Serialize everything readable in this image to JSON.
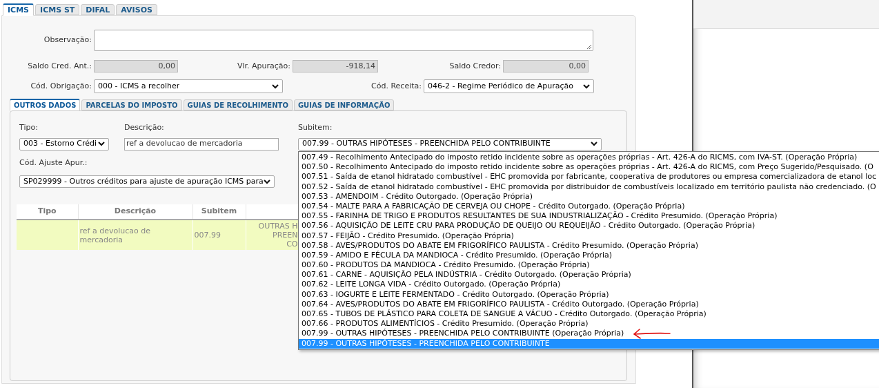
{
  "tabs": [
    {
      "label": "ICMS",
      "selected": true
    },
    {
      "label": "ICMS ST",
      "selected": false
    },
    {
      "label": "DIFAL",
      "selected": false
    },
    {
      "label": "AVISOS",
      "selected": false
    }
  ],
  "observacao": {
    "label": "Observação:"
  },
  "totals": [
    {
      "label": "Saldo Cred. Ant.:",
      "value": "0,00"
    },
    {
      "label": "Vlr. Apuração:",
      "value": "-918,14"
    },
    {
      "label": "Saldo Credor:",
      "value": "0,00"
    }
  ],
  "codes": [
    {
      "label": "Cód. Obrigação:",
      "value": "000 - ICMS a recolher"
    },
    {
      "label": "Cód. Receita:",
      "value": "046-2 - Regime Periódico de Apuração"
    }
  ],
  "subtabs": [
    {
      "label": "OUTROS DADOS",
      "selected": true
    },
    {
      "label": "PARCELAS DO IMPOSTO",
      "selected": false
    },
    {
      "label": "GUIAS DE RECOLHIMENTO",
      "selected": false
    },
    {
      "label": "GUIAS DE INFORMAÇÃO",
      "selected": false
    }
  ],
  "tipo": {
    "label": "Tipo:",
    "value": "003 - Estorno Crédi"
  },
  "descricao": {
    "label": "Descrição:",
    "value": "ref a devolucao de mercadoria"
  },
  "subitem": {
    "label": "Subitem:",
    "value": "007.99 - OUTRAS HIPÓTESES - PREENCHIDA PELO CONTRIBUINTE"
  },
  "ajuste": {
    "label": "Cód. Ajuste Apur.:",
    "value": "SP029999 - Outros créditos para ajuste de apuração ICMS para"
  },
  "table": {
    "columns": [
      "Tipo",
      "Descrição",
      "Subitem"
    ],
    "rows": [
      {
        "cells": [
          "",
          "ref a devolucao de mercadoria",
          "007.99",
          [
            "OUTRAS H",
            "PREEN",
            "CO"
          ]
        ]
      }
    ]
  },
  "subitem_options": [
    {
      "label": "007.49 - Recolhimento Antecipado do imposto retido incidente sobre as operações próprias - Art. 426-A do RICMS, com IVA-ST. (Operação Própria)",
      "selected": false
    },
    {
      "label": "007.50 - Recolhimento Antecipado do imposto retido incidente sobre as operações próprias - Art. 426-A do RICMS, com Preço Sugerido/Pesquisado. (O",
      "selected": false
    },
    {
      "label": "007.51 - Saída de etanol hidratado combustível - EHC promovida por fabricante, cooperativa de produtores ou empresa comercializadora de etanol loc",
      "selected": false
    },
    {
      "label": "007.52 - Saída de etanol hidratado combustível - EHC promovida por distribuidor de combustíveis localizado em território paulista não credenciado. (O",
      "selected": false
    },
    {
      "label": "007.53 - AMENDOIM - Crédito Outorgado. (Operação Própria)",
      "selected": false
    },
    {
      "label": "007.54 - MALTE PARA A FABRICAÇÃO DE CERVEJA OU CHOPE - Crédito Outorgado. (Operação Própria)",
      "selected": false
    },
    {
      "label": "007.55 - FARINHA DE TRIGO E PRODUTOS RESULTANTES DE SUA INDUSTRIALIZAÇÃO - Crédito Presumido. (Operação Própria)",
      "selected": false
    },
    {
      "label": "007.56 - AQUISIÇÃO DE LEITE CRU PARA PRODUÇÃO DE QUEIJO OU REQUEIJÃO - Crédito Outorgado. (Operação Própria)",
      "selected": false
    },
    {
      "label": "007.57 - FEIJÃO - Crédito Presumido. (Operação Própria)",
      "selected": false
    },
    {
      "label": "007.58 - AVES/PRODUTOS DO ABATE EM FRIGORÍFICO PAULISTA - Crédito Presumido. (Operação Própria)",
      "selected": false
    },
    {
      "label": "007.59 - AMIDO E FÉCULA DA MANDIOCA - Crédito Presumido. (Operação Própria)",
      "selected": false
    },
    {
      "label": "007.60 - PRODUTOS DA MANDIOCA - Crédito Presumido. (Operação Própria)",
      "selected": false
    },
    {
      "label": "007.61 - CARNE - AQUISIÇÃO PELA INDÚSTRIA - Crédito Outorgado. (Operação Própria)",
      "selected": false
    },
    {
      "label": "007.62 - LEITE LONGA VIDA - Crédito Outorgado. (Operação Própria)",
      "selected": false
    },
    {
      "label": "007.63 - IOGURTE E LEITE FERMENTADO - Crédito Outorgado. (Operação Própria)",
      "selected": false
    },
    {
      "label": "007.64 - AVES/PRODUTOS DO ABATE EM FRIGORÍFICO PAULISTA - Crédito Outorgado. (Operação Própria)",
      "selected": false
    },
    {
      "label": "007.65 - TUBOS DE PLÁSTICO PARA COLETA DE SANGUE A VÁCUO - Crédito Outorgado. (Operação Própria)",
      "selected": false
    },
    {
      "label": "007.66 - PRODUTOS ALIMENTÍCIOS - Crédito Presumido. (Operação Própria)",
      "selected": false
    },
    {
      "label": "007.99 - OUTRAS HIPÓTESES - PREENCHIDA PELO CONTRIBUINTE (Operação Própria)",
      "selected": false
    },
    {
      "label": "007.99 - OUTRAS HIPÓTESES - PREENCHIDA PELO CONTRIBUINTE",
      "selected": true
    }
  ]
}
